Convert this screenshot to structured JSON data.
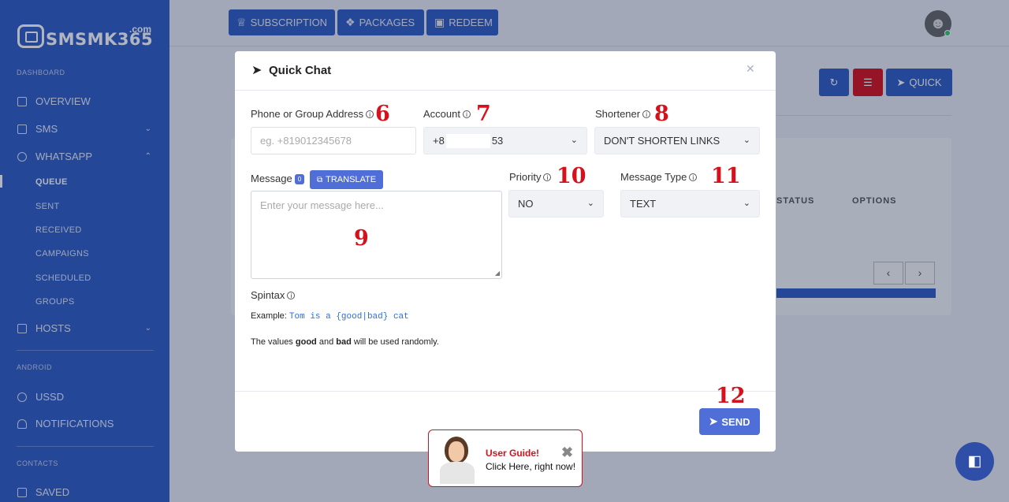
{
  "brand": {
    "name": "SMSMK365",
    "tld": ".com"
  },
  "sidebar": {
    "sections": {
      "dashboard": "DASHBOARD",
      "android": "ANDROID",
      "contacts": "CONTACTS"
    },
    "items": [
      {
        "label": "OVERVIEW"
      },
      {
        "label": "SMS"
      },
      {
        "label": "WHATSAPP"
      },
      {
        "label": "HOSTS"
      },
      {
        "label": "USSD"
      },
      {
        "label": "NOTIFICATIONS"
      },
      {
        "label": "SAVED"
      }
    ],
    "whatsapp_sub": [
      "QUEUE",
      "SENT",
      "RECEIVED",
      "CAMPAIGNS",
      "SCHEDULED",
      "GROUPS"
    ],
    "active_sub": "QUEUE"
  },
  "topbar": {
    "subscription": "SUBSCRIPTION",
    "packages": "PACKAGES",
    "redeem": "REDEEM"
  },
  "background": {
    "quick_label": "QUICK",
    "columns": {
      "status": "STATUS",
      "options": "OPTIONS"
    }
  },
  "modal": {
    "title": "Quick Chat",
    "phone": {
      "label": "Phone or Group Address",
      "placeholder": "eg. +819012345678",
      "marker": "6"
    },
    "account": {
      "label": "Account",
      "value_start": "+8",
      "value_end": "53",
      "marker": "7"
    },
    "shortener": {
      "label": "Shortener",
      "value": "DON'T SHORTEN LINKS",
      "marker": "8"
    },
    "message": {
      "label": "Message",
      "count": "0",
      "translate": "TRANSLATE",
      "placeholder": "Enter your message here...",
      "marker": "9"
    },
    "priority": {
      "label": "Priority",
      "value": "NO",
      "marker": "10"
    },
    "message_type": {
      "label": "Message Type",
      "value": "TEXT",
      "marker": "11"
    },
    "spintax": {
      "label": "Spintax",
      "example_prefix": "Example:",
      "example_code": "Tom is a {good|bad} cat",
      "note_1": "The values",
      "good": "good",
      "and": "and",
      "bad": "bad",
      "note_2": "will be used randomly."
    },
    "send": {
      "label": "SEND",
      "marker": "12"
    }
  },
  "guide": {
    "title": "User Guide!",
    "subtitle": "Click Here, right now!"
  },
  "colors": {
    "primary": "#2f5cc4",
    "button": "#4f6ed8",
    "marker": "#d6111b"
  }
}
